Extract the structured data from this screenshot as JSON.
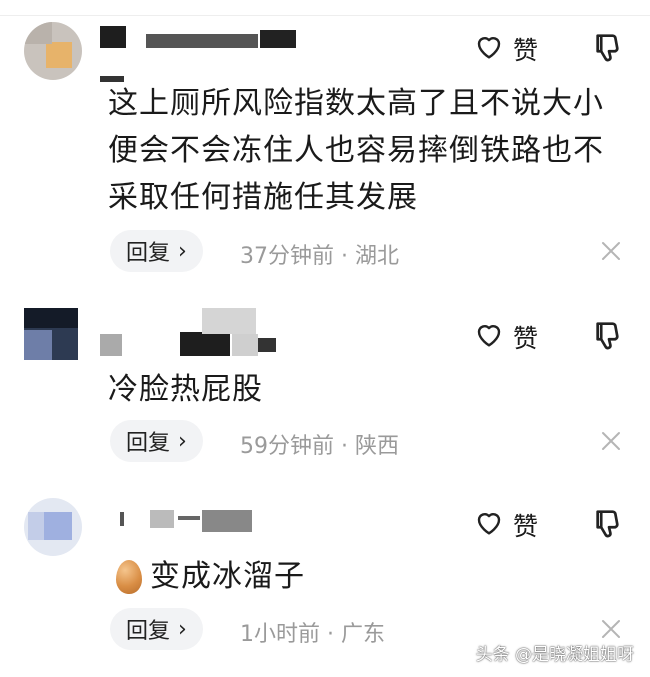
{
  "comments": [
    {
      "text": "这上厕所风险指数太高了且不说大小便会不会冻住人也容易摔倒铁路也不采取任何措施任其发展",
      "like_label": "赞",
      "reply_label": "回复",
      "reply_chevron": "›",
      "time": "37分钟前",
      "separator": "·",
      "location": "湖北"
    },
    {
      "text": "冷脸热屁股",
      "like_label": "赞",
      "reply_label": "回复",
      "reply_chevron": "›",
      "time": "59分钟前",
      "separator": "·",
      "location": "陕西"
    },
    {
      "text": "变成冰溜子",
      "emoji": "egg",
      "like_label": "赞",
      "reply_label": "回复",
      "reply_chevron": "›",
      "time": "1小时前",
      "separator": "·",
      "location": "广东"
    }
  ],
  "icons": {
    "like": "heart-outline-icon",
    "dislike": "thumbs-down-icon",
    "close": "close-icon"
  },
  "watermark": "头条 @是晓凝姐姐呀",
  "colors": {
    "text": "#1a1a1a",
    "meta": "#9a9a9a",
    "reply_bg": "#f2f3f5",
    "divider": "#eeeeee"
  }
}
